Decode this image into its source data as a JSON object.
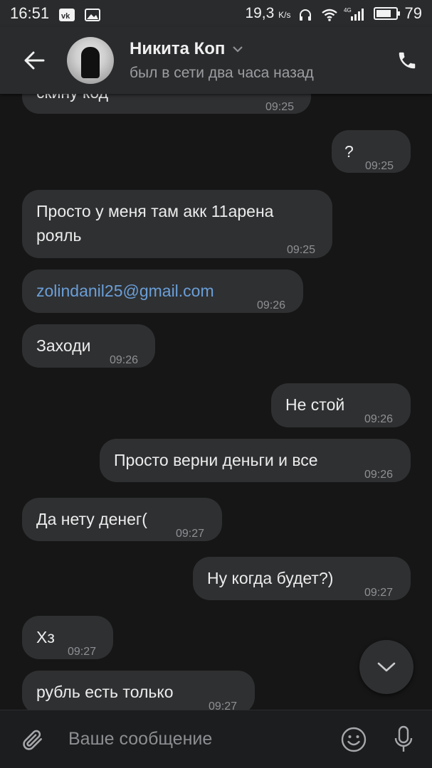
{
  "status_bar": {
    "time": "16:51",
    "speed_value": "19,3",
    "speed_unit": "K/s",
    "network": "4G",
    "battery": "79",
    "battery_level": 0.79
  },
  "header": {
    "contact_name": "Никита Коп",
    "contact_status": "был в сети два часа назад"
  },
  "messages": [
    {
      "text": "скину код",
      "time": "09:25",
      "direction": "incoming"
    },
    {
      "text": "?",
      "time": "09:25",
      "direction": "outgoing"
    },
    {
      "text": "Просто у меня там акк 11арена рояль",
      "line1": "Просто у меня там акк 11арена",
      "line2": "рояль",
      "time": "09:25",
      "direction": "incoming"
    },
    {
      "text": "zolindanil25@gmail.com",
      "time": "09:26",
      "direction": "incoming",
      "is_link": true
    },
    {
      "text": "Заходи",
      "time": "09:26",
      "direction": "incoming"
    },
    {
      "text": "Не стой",
      "time": "09:26",
      "direction": "outgoing"
    },
    {
      "text": "Просто верни деньги и все",
      "time": "09:26",
      "direction": "outgoing"
    },
    {
      "text": "Да нету денег(",
      "time": "09:27",
      "direction": "incoming"
    },
    {
      "text": "Ну когда будет?)",
      "time": "09:27",
      "direction": "outgoing"
    },
    {
      "text": "Хз",
      "time": "09:27",
      "direction": "incoming"
    },
    {
      "text": "рубль есть только",
      "time": "09:27",
      "direction": "incoming"
    }
  ],
  "input": {
    "placeholder": "Ваше сообщение"
  },
  "colors": {
    "background": "#161616",
    "bubble": "#2f3032",
    "header": "#2a2b2d",
    "link": "#6a9fd8",
    "time": "#8e9093"
  }
}
